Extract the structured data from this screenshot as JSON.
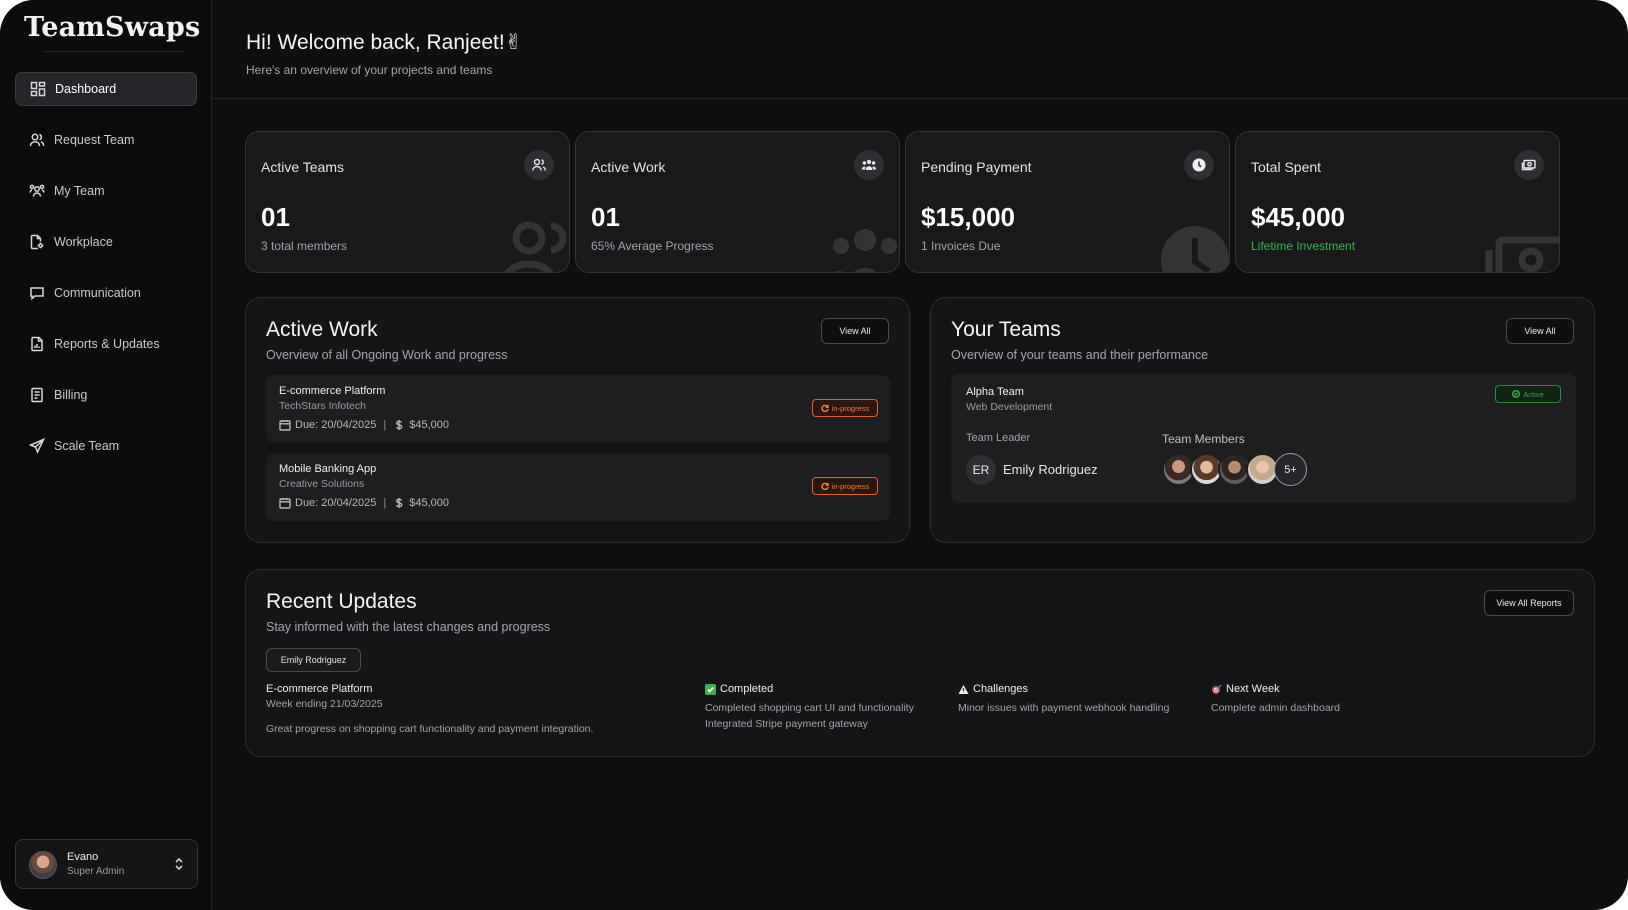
{
  "app": {
    "brand": "TeamSwaps"
  },
  "sidebar": {
    "items": [
      {
        "label": "Dashboard",
        "icon": "dashboard-icon",
        "active": true
      },
      {
        "label": "Request Team",
        "icon": "users-icon"
      },
      {
        "label": "My Team",
        "icon": "team-icon"
      },
      {
        "label": "Workplace",
        "icon": "document-gear-icon"
      },
      {
        "label": "Communication",
        "icon": "chat-icon"
      },
      {
        "label": "Reports & Updates",
        "icon": "report-icon"
      },
      {
        "label": "Billing",
        "icon": "receipt-icon"
      },
      {
        "label": "Scale Team",
        "icon": "send-icon"
      }
    ],
    "user": {
      "name": "Evano",
      "role": "Super Admin"
    }
  },
  "header": {
    "greeting": "Hi! Welcome back, Ranjeet!✌",
    "subtitle": "Here's an overview of your projects and teams"
  },
  "stats": [
    {
      "title": "Active Teams",
      "value": "01",
      "sub": "3 total members",
      "icon": "users-icon"
    },
    {
      "title": "Active Work",
      "value": "01",
      "sub": "65% Average Progress",
      "icon": "group-icon"
    },
    {
      "title": "Pending Payment",
      "value": "$15,000",
      "sub": "1 Invoices Due",
      "icon": "clock-icon"
    },
    {
      "title": "Total Spent",
      "value": "$45,000",
      "sub": "Lifetime Investment",
      "icon": "money-icon",
      "sub_color": "#38b44a"
    }
  ],
  "active_work": {
    "title": "Active Work",
    "subtitle": "Overview of all Ongoing Work and progress",
    "view_all": "View All",
    "items": [
      {
        "name": "E-commerce Platform",
        "client": "TechStars Infotech",
        "due": "Due: 20/04/2025",
        "amount": "$45,000",
        "status": "in-progress"
      },
      {
        "name": "Mobile Banking App",
        "client": "Creative Solutions",
        "due": "Due: 20/04/2025",
        "amount": "$45,000",
        "status": "in-progress"
      }
    ]
  },
  "your_teams": {
    "title": "Your Teams",
    "subtitle": "Overview of your teams and their performance",
    "view_all": "View All",
    "team": {
      "name": "Alpha Team",
      "type": "Web Development",
      "status": "Active",
      "leader_label": "Team Leader",
      "leader_initials": "ER",
      "leader_name": "Emily Rodriguez",
      "members_label": "Team Members",
      "more": "5+"
    }
  },
  "recent_updates": {
    "title": "Recent Updates",
    "subtitle": "Stay informed with the latest changes and progress",
    "view_all": "View All Reports",
    "chip": "Emily Rodriguez",
    "project": "E-commerce Platform",
    "week": "Week ending 21/03/2025",
    "summary": "Great progress on shopping cart functionality and payment integration.",
    "completed_title": "Completed",
    "completed_1": "Completed shopping cart UI and functionality",
    "completed_2": "Integrated Stripe payment gateway",
    "challenges_title": "Challenges",
    "challenges_1": "Minor issues with payment webhook handling",
    "next_title": "Next Week",
    "next_1": "Complete admin dashboard"
  },
  "colors": {
    "accent_orange": "#f07a3c",
    "accent_green": "#3aa34a",
    "background": "#0f0f11"
  }
}
